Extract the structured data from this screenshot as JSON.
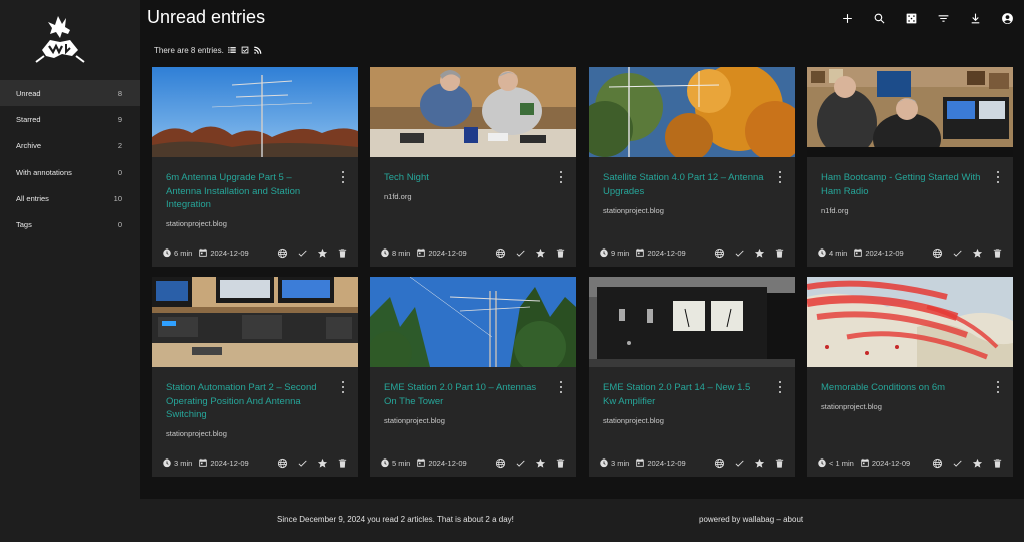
{
  "page_title": "Unread entries",
  "summary": {
    "text": "There are 8 entries."
  },
  "sidebar": {
    "items": [
      {
        "label": "Unread",
        "count": "8"
      },
      {
        "label": "Starred",
        "count": "9"
      },
      {
        "label": "Archive",
        "count": "2"
      },
      {
        "label": "With annotations",
        "count": "0"
      },
      {
        "label": "All entries",
        "count": "10"
      },
      {
        "label": "Tags",
        "count": "0"
      }
    ]
  },
  "header_icons": [
    "add-icon",
    "search-icon",
    "random-icon",
    "filter-icon",
    "export-icon",
    "account-icon"
  ],
  "cards": [
    {
      "title": "6m Antenna Upgrade Part 5 – Antenna Installation and Station Integration",
      "domain": "stationproject.blog",
      "reading_time": "6 min",
      "date": "2024-12-09"
    },
    {
      "title": "Tech Night",
      "domain": "n1fd.org",
      "reading_time": "8 min",
      "date": "2024-12-09"
    },
    {
      "title": "Satellite Station 4.0 Part 12 – Antenna Upgrades",
      "domain": "stationproject.blog",
      "reading_time": "9 min",
      "date": "2024-12-09"
    },
    {
      "title": "Ham Bootcamp - Getting Started With Ham Radio",
      "domain": "n1fd.org",
      "reading_time": "4 min",
      "date": "2024-12-09"
    },
    {
      "title": "Station Automation Part 2 – Second Operating Position And Antenna Switching",
      "domain": "stationproject.blog",
      "reading_time": "3 min",
      "date": "2024-12-09"
    },
    {
      "title": "EME Station 2.0 Part 10 – Antennas On The Tower",
      "domain": "stationproject.blog",
      "reading_time": "5 min",
      "date": "2024-12-09"
    },
    {
      "title": "EME Station 2.0 Part 14 – New 1.5 Kw Amplifier",
      "domain": "stationproject.blog",
      "reading_time": "3 min",
      "date": "2024-12-09"
    },
    {
      "title": "Memorable Conditions on 6m",
      "domain": "stationproject.blog",
      "reading_time": "< 1 min",
      "date": "2024-12-09"
    }
  ],
  "footer": {
    "stats": "Since December 9, 2024 you read 2 articles. That is about 2 a day!",
    "powered_by": "powered by",
    "wallabag_link": "wallabag",
    "dash": "–",
    "about_link": "about"
  },
  "colors": {
    "accent": "#26a69a",
    "background": "#121212",
    "card": "#262626",
    "sidebar": "#1e1e1e"
  }
}
